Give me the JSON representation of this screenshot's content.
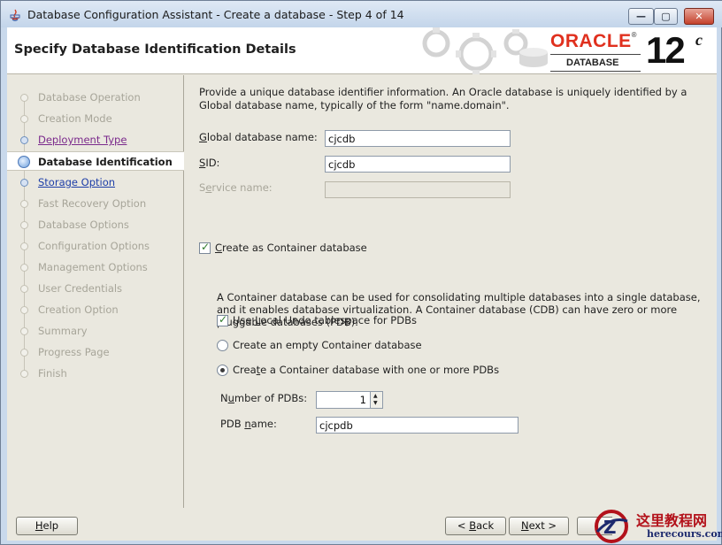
{
  "window": {
    "title": "Database Configuration Assistant - Create a database - Step 4 of 14",
    "minimize_glyph": "—",
    "maximize_glyph": "▢",
    "close_glyph": "✕"
  },
  "header": {
    "title": "Specify Database Identification Details",
    "logo_brand": "ORACLE",
    "logo_reg": "®",
    "logo_product": "DATABASE",
    "logo_version": "12",
    "logo_version_suffix": "c"
  },
  "steps": [
    {
      "label": "Database Operation",
      "state": "disabled"
    },
    {
      "label": "Creation Mode",
      "state": "disabled"
    },
    {
      "label": "Deployment Type",
      "state": "visited"
    },
    {
      "label": "Database Identification",
      "state": "current"
    },
    {
      "label": "Storage Option",
      "state": "link"
    },
    {
      "label": "Fast Recovery Option",
      "state": "disabled"
    },
    {
      "label": "Database Options",
      "state": "disabled"
    },
    {
      "label": "Configuration Options",
      "state": "disabled"
    },
    {
      "label": "Management Options",
      "state": "disabled"
    },
    {
      "label": "User Credentials",
      "state": "disabled"
    },
    {
      "label": "Creation Option",
      "state": "disabled"
    },
    {
      "label": "Summary",
      "state": "disabled"
    },
    {
      "label": "Progress Page",
      "state": "disabled"
    },
    {
      "label": "Finish",
      "state": "disabled"
    }
  ],
  "main": {
    "intro": "Provide a unique database identifier information. An Oracle database is uniquely identified by a Global database name, typically of the form \"name.domain\".",
    "global_db_label": "Global database name:",
    "global_db_value": "cjcdb",
    "sid_label": "SID:",
    "sid_value": "cjcdb",
    "service_label": "Service name:",
    "service_value": "",
    "container_checkbox_label": "Create as Container database",
    "container_checked": true,
    "container_desc": "A Container database can be used for consolidating multiple databases into a single database, and it enables database virtualization. A Container database (CDB) can have zero or more pluggable databases (PDB).",
    "local_undo_label": "Use Local Undo tablespace for PDBs",
    "local_undo_checked": true,
    "empty_cdb_label": "Create an empty Container database",
    "with_pdbs_label": "Create a Container database with one or more PDBs",
    "selected_option": "with_pdbs",
    "num_pdbs_label": "Number of PDBs:",
    "num_pdbs_value": "1",
    "pdb_name_label": "PDB name:",
    "pdb_name_value": "cjcpdb"
  },
  "buttons": {
    "help": "Help",
    "back": "< Back",
    "next": "Next >"
  },
  "watermark": {
    "cn": "这里教程网",
    "url": "herecours.com"
  }
}
